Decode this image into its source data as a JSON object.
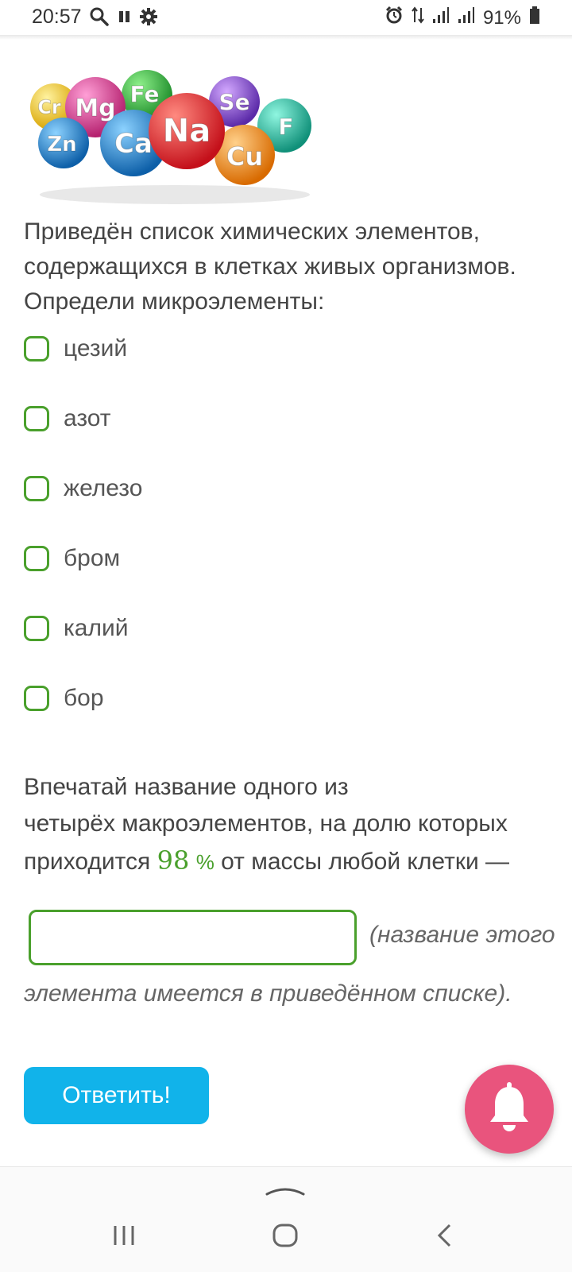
{
  "status_bar": {
    "time": "20:57",
    "battery": "91%",
    "icons": [
      "search-icon",
      "pause-icon",
      "gear-icon",
      "alarm-icon",
      "data-arrows-icon",
      "signal-icon",
      "signal-icon",
      "battery-icon"
    ]
  },
  "hero_image": {
    "symbols": [
      "Cr",
      "Mg",
      "Fe",
      "Se",
      "F",
      "Zn",
      "Ca",
      "Na",
      "Cu"
    ]
  },
  "question": {
    "text": "Приведён список химических элементов, содержащихся в клетках живых организмов. Определи микроэлементы:"
  },
  "options": [
    {
      "label": "цезий",
      "checked": false
    },
    {
      "label": "азот",
      "checked": false
    },
    {
      "label": "железо",
      "checked": false
    },
    {
      "label": "бром",
      "checked": false
    },
    {
      "label": "калий",
      "checked": false
    },
    {
      "label": "бор",
      "checked": false
    }
  ],
  "task2": {
    "line1": "Впечатай название одного из",
    "line2": "четырёх макроэлементов, на долю которых",
    "line3_before": "приходится ",
    "percent_value": "98",
    "percent_sign": "%",
    "line3_after": " от массы любой клетки —",
    "input_value": "",
    "hint_part1": "(название этого",
    "hint_part2": "элемента имеется в приведённом списке)."
  },
  "buttons": {
    "submit": "Ответить!"
  },
  "colors": {
    "accent_green": "#4aa02c",
    "button_blue": "#11b3ea",
    "bell_pink": "#e9547d"
  },
  "nav_bar": {
    "icons": [
      "chevron-up-icon",
      "recent-apps-icon",
      "home-icon",
      "back-icon"
    ]
  }
}
